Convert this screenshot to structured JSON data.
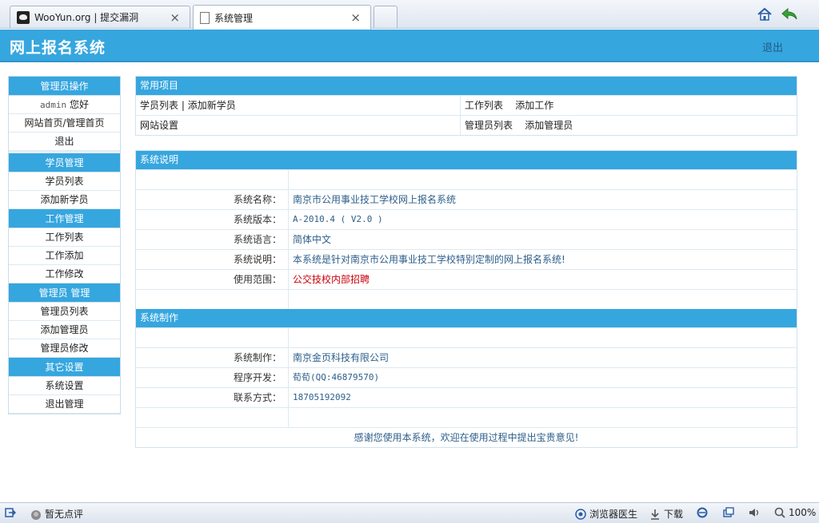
{
  "browser": {
    "tabs": [
      {
        "label": "WooYun.org | 提交漏洞"
      },
      {
        "label": "系统管理"
      }
    ],
    "close_glyph": "×"
  },
  "header": {
    "title": "网上报名系统",
    "logout": "退出"
  },
  "sidebar": {
    "sections": [
      {
        "title": "管理员操作",
        "items": [
          "网站首页/管理首页",
          "退出"
        ]
      },
      {
        "title": "学员管理",
        "items": [
          "学员列表",
          "添加新学员"
        ]
      },
      {
        "title": "工作管理",
        "items": [
          "工作列表",
          "工作添加",
          "工作修改"
        ]
      },
      {
        "title": "管理员 管理",
        "items": [
          "管理员列表",
          "添加管理员",
          "管理员修改"
        ]
      },
      {
        "title": "其它设置",
        "items": [
          "系统设置",
          "退出管理"
        ]
      }
    ],
    "user": {
      "name": "admin",
      "greeting": "您好"
    }
  },
  "common": {
    "title": "常用项目",
    "row1": {
      "student_list": "学员列表",
      "sep": "|",
      "add_student": "添加新学员",
      "job_list": "工作列表",
      "add_job": "添加工作"
    },
    "row2": {
      "site_settings": "网站设置",
      "admin_list": "管理员列表",
      "add_admin": "添加管理员"
    }
  },
  "sysinfo": {
    "title": "系统说明",
    "rows": [
      {
        "label": "系统名称：",
        "value": "南京市公用事业技工学校网上报名系统"
      },
      {
        "label": "系统版本：",
        "value": "A-2010.4 ( V2.0 )"
      },
      {
        "label": "系统语言：",
        "value": "简体中文"
      },
      {
        "label": "系统说明：",
        "value": "本系统是针对南京市公用事业技工学校特别定制的网上报名系统!"
      },
      {
        "label": "使用范围：",
        "value": "公交技校内部招聘"
      }
    ]
  },
  "sysmake": {
    "title": "系统制作",
    "rows": [
      {
        "label": "系统制作：",
        "value": "南京金页科技有限公司"
      },
      {
        "label": "程序开发：",
        "value": "荀荀(QQ:46879570)"
      },
      {
        "label": "联系方式：",
        "value": "18705192092"
      }
    ],
    "footer": "感谢您使用本系统，欢迎在使用过程中提出宝贵意见!"
  },
  "statusbar": {
    "comment": "暂无点评",
    "doctor": "浏览器医生",
    "download": "下载",
    "zoom": "100%"
  },
  "colors": {
    "accent": "#36a6df",
    "value_text": "#2d5f8a",
    "highlight_red": "#c8000b"
  },
  "icons": [
    "wooyun-logo-icon",
    "page-icon",
    "home-icon",
    "back-arrow-icon",
    "exit-icon",
    "comment-icon",
    "shield-icon",
    "download-icon",
    "ie-icon",
    "window-icon",
    "speaker-icon",
    "zoom-icon"
  ]
}
